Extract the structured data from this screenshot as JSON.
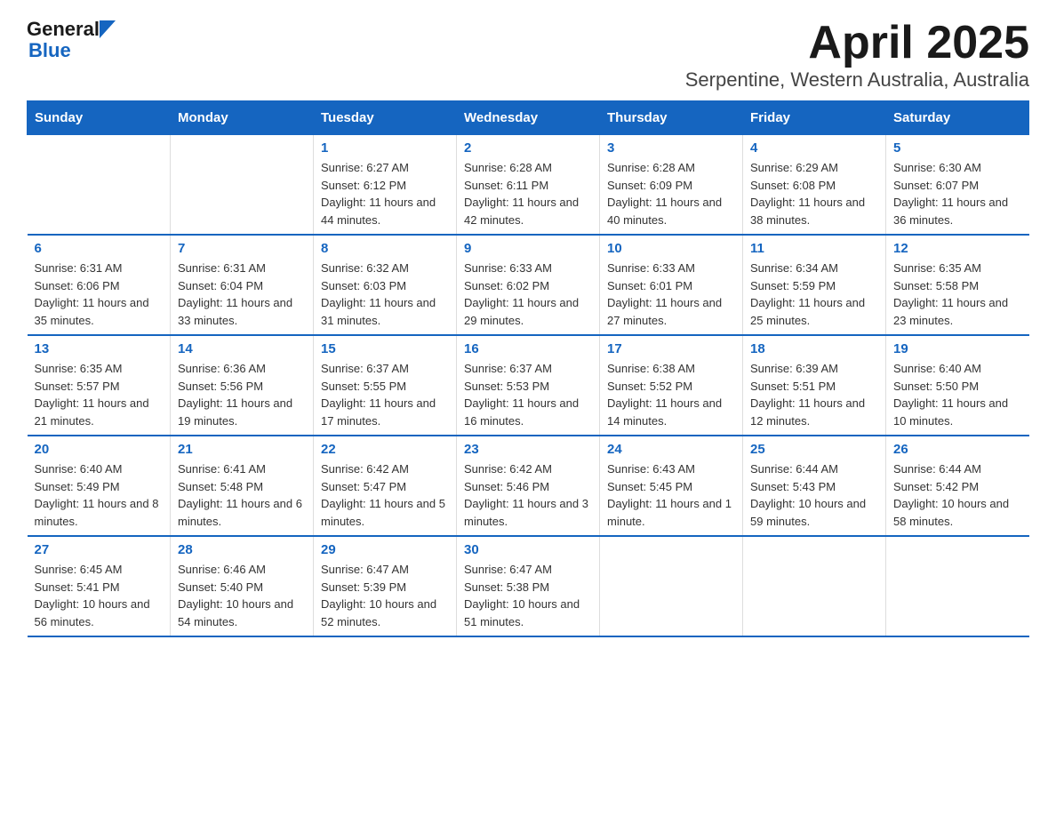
{
  "header": {
    "logo_general": "General",
    "logo_blue": "Blue",
    "title": "April 2025",
    "subtitle": "Serpentine, Western Australia, Australia"
  },
  "calendar": {
    "days_of_week": [
      "Sunday",
      "Monday",
      "Tuesday",
      "Wednesday",
      "Thursday",
      "Friday",
      "Saturday"
    ],
    "weeks": [
      [
        {
          "day": "",
          "info": ""
        },
        {
          "day": "",
          "info": ""
        },
        {
          "day": "1",
          "info": "Sunrise: 6:27 AM\nSunset: 6:12 PM\nDaylight: 11 hours\nand 44 minutes."
        },
        {
          "day": "2",
          "info": "Sunrise: 6:28 AM\nSunset: 6:11 PM\nDaylight: 11 hours\nand 42 minutes."
        },
        {
          "day": "3",
          "info": "Sunrise: 6:28 AM\nSunset: 6:09 PM\nDaylight: 11 hours\nand 40 minutes."
        },
        {
          "day": "4",
          "info": "Sunrise: 6:29 AM\nSunset: 6:08 PM\nDaylight: 11 hours\nand 38 minutes."
        },
        {
          "day": "5",
          "info": "Sunrise: 6:30 AM\nSunset: 6:07 PM\nDaylight: 11 hours\nand 36 minutes."
        }
      ],
      [
        {
          "day": "6",
          "info": "Sunrise: 6:31 AM\nSunset: 6:06 PM\nDaylight: 11 hours\nand 35 minutes."
        },
        {
          "day": "7",
          "info": "Sunrise: 6:31 AM\nSunset: 6:04 PM\nDaylight: 11 hours\nand 33 minutes."
        },
        {
          "day": "8",
          "info": "Sunrise: 6:32 AM\nSunset: 6:03 PM\nDaylight: 11 hours\nand 31 minutes."
        },
        {
          "day": "9",
          "info": "Sunrise: 6:33 AM\nSunset: 6:02 PM\nDaylight: 11 hours\nand 29 minutes."
        },
        {
          "day": "10",
          "info": "Sunrise: 6:33 AM\nSunset: 6:01 PM\nDaylight: 11 hours\nand 27 minutes."
        },
        {
          "day": "11",
          "info": "Sunrise: 6:34 AM\nSunset: 5:59 PM\nDaylight: 11 hours\nand 25 minutes."
        },
        {
          "day": "12",
          "info": "Sunrise: 6:35 AM\nSunset: 5:58 PM\nDaylight: 11 hours\nand 23 minutes."
        }
      ],
      [
        {
          "day": "13",
          "info": "Sunrise: 6:35 AM\nSunset: 5:57 PM\nDaylight: 11 hours\nand 21 minutes."
        },
        {
          "day": "14",
          "info": "Sunrise: 6:36 AM\nSunset: 5:56 PM\nDaylight: 11 hours\nand 19 minutes."
        },
        {
          "day": "15",
          "info": "Sunrise: 6:37 AM\nSunset: 5:55 PM\nDaylight: 11 hours\nand 17 minutes."
        },
        {
          "day": "16",
          "info": "Sunrise: 6:37 AM\nSunset: 5:53 PM\nDaylight: 11 hours\nand 16 minutes."
        },
        {
          "day": "17",
          "info": "Sunrise: 6:38 AM\nSunset: 5:52 PM\nDaylight: 11 hours\nand 14 minutes."
        },
        {
          "day": "18",
          "info": "Sunrise: 6:39 AM\nSunset: 5:51 PM\nDaylight: 11 hours\nand 12 minutes."
        },
        {
          "day": "19",
          "info": "Sunrise: 6:40 AM\nSunset: 5:50 PM\nDaylight: 11 hours\nand 10 minutes."
        }
      ],
      [
        {
          "day": "20",
          "info": "Sunrise: 6:40 AM\nSunset: 5:49 PM\nDaylight: 11 hours\nand 8 minutes."
        },
        {
          "day": "21",
          "info": "Sunrise: 6:41 AM\nSunset: 5:48 PM\nDaylight: 11 hours\nand 6 minutes."
        },
        {
          "day": "22",
          "info": "Sunrise: 6:42 AM\nSunset: 5:47 PM\nDaylight: 11 hours\nand 5 minutes."
        },
        {
          "day": "23",
          "info": "Sunrise: 6:42 AM\nSunset: 5:46 PM\nDaylight: 11 hours\nand 3 minutes."
        },
        {
          "day": "24",
          "info": "Sunrise: 6:43 AM\nSunset: 5:45 PM\nDaylight: 11 hours\nand 1 minute."
        },
        {
          "day": "25",
          "info": "Sunrise: 6:44 AM\nSunset: 5:43 PM\nDaylight: 10 hours\nand 59 minutes."
        },
        {
          "day": "26",
          "info": "Sunrise: 6:44 AM\nSunset: 5:42 PM\nDaylight: 10 hours\nand 58 minutes."
        }
      ],
      [
        {
          "day": "27",
          "info": "Sunrise: 6:45 AM\nSunset: 5:41 PM\nDaylight: 10 hours\nand 56 minutes."
        },
        {
          "day": "28",
          "info": "Sunrise: 6:46 AM\nSunset: 5:40 PM\nDaylight: 10 hours\nand 54 minutes."
        },
        {
          "day": "29",
          "info": "Sunrise: 6:47 AM\nSunset: 5:39 PM\nDaylight: 10 hours\nand 52 minutes."
        },
        {
          "day": "30",
          "info": "Sunrise: 6:47 AM\nSunset: 5:38 PM\nDaylight: 10 hours\nand 51 minutes."
        },
        {
          "day": "",
          "info": ""
        },
        {
          "day": "",
          "info": ""
        },
        {
          "day": "",
          "info": ""
        }
      ]
    ]
  }
}
